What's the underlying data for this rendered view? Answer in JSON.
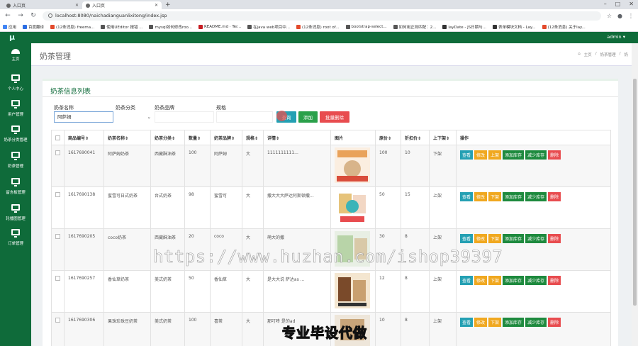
{
  "browser": {
    "tabs": [
      {
        "label": "入口页"
      },
      {
        "label": "入口页"
      }
    ],
    "new_tab": "+",
    "url": "localhost:8080/naichadianguanlixitong/index.jsp",
    "bookmarks": [
      "应用",
      "百度翻译",
      "(12条消息) freema...",
      "使用UEditor 报错 ...",
      "mysql如何修改roo...",
      "README.md · Ter...",
      "在java web项目中...",
      "(12条消息) root of...",
      "bootstrap-select...",
      "如何用正则匹配：2...",
      "layDate - JS日期与...",
      "表单模块文档 - Lay...",
      "(12条消息) 关于lay..."
    ]
  },
  "app": {
    "logo": "μ",
    "user": "admin ▾",
    "sidebar": [
      {
        "label": "主页",
        "icon": "dashboard-icon"
      },
      {
        "label": "个人中心",
        "icon": "monitor-icon"
      },
      {
        "label": "用户管理",
        "icon": "monitor-icon"
      },
      {
        "label": "奶茶分类管理",
        "icon": "monitor-icon"
      },
      {
        "label": "奶茶管理",
        "icon": "monitor-icon"
      },
      {
        "label": "留言板管理",
        "icon": "monitor-icon"
      },
      {
        "label": "轮播图管理",
        "icon": "monitor-icon"
      },
      {
        "label": "订单管理",
        "icon": "monitor-icon"
      }
    ],
    "page_title": "奶茶管理",
    "breadcrumb": [
      "主页",
      "奶茶管理",
      "奶"
    ]
  },
  "list": {
    "title": "奶茶信息列表",
    "filters": {
      "name_label": "奶茶名称",
      "name_value": "阿萨姆",
      "category_label": "奶茶分类",
      "category_value": "",
      "brand_label": "奶茶品牌",
      "brand_value": "",
      "spec_label": "规格",
      "spec_value": ""
    },
    "buttons": {
      "search": "查询",
      "add": "添加",
      "batch_delete": "批量删除"
    },
    "columns": [
      "",
      "商品编号",
      "奶茶名称",
      "奶茶分类",
      "数量",
      "奶茶品牌",
      "规格",
      "详情",
      "图片",
      "原价",
      "折扣价",
      "上下架",
      "操作"
    ],
    "rows": [
      {
        "id": "1617690041",
        "name": "阿萨姆奶茶",
        "category": "西藏酥油茶",
        "qty": "100",
        "brand": "阿萨姆",
        "spec": "大",
        "detail": "1111111111...",
        "price": "100",
        "discount": "10",
        "shelf": "下架",
        "toggle": "上架"
      },
      {
        "id": "1617690138",
        "name": "蜜雪可日式奶茶",
        "category": "台式奶茶",
        "qty": "98",
        "brand": "蜜雪可",
        "spec": "大",
        "detail": "撒大大大萨达阿斯顿撒...",
        "price": "50",
        "discount": "15",
        "shelf": "上架",
        "toggle": "下架"
      },
      {
        "id": "1617690205",
        "name": "coco奶茶",
        "category": "西藏酥油茶",
        "qty": "20",
        "brand": "coco",
        "spec": "大",
        "detail": "萌大的撒",
        "price": "30",
        "discount": "8",
        "shelf": "上架",
        "toggle": "下架"
      },
      {
        "id": "1617690257",
        "name": "香仙草奶茶",
        "category": "美式奶茶",
        "qty": "50",
        "brand": "香仙草",
        "spec": "大",
        "detail": "是大大说 萨达as ...",
        "price": "12",
        "discount": "8",
        "shelf": "上架",
        "toggle": "下架"
      },
      {
        "id": "1617690306",
        "name": "果珠珍珠豆奶茶",
        "category": "美式奶茶",
        "qty": "100",
        "brand": "喜茶",
        "spec": "大",
        "detail": "那叮咚 是的ad",
        "price": "10",
        "discount": "8",
        "shelf": "上架",
        "toggle": "下架"
      }
    ],
    "row_actions": {
      "view": "查看",
      "edit": "修改",
      "inc": "添加库存",
      "dec": "减少库存",
      "del": "删除"
    }
  },
  "overlay": {
    "watermark": "https://www.huzhan.com/ishop39397",
    "caption": "专业毕设代做"
  },
  "colors": {
    "brand": "#0f6b3a",
    "info": "#24a0b3",
    "warning": "#f0a820",
    "success": "#1e8a3e",
    "danger": "#e84c4f"
  }
}
